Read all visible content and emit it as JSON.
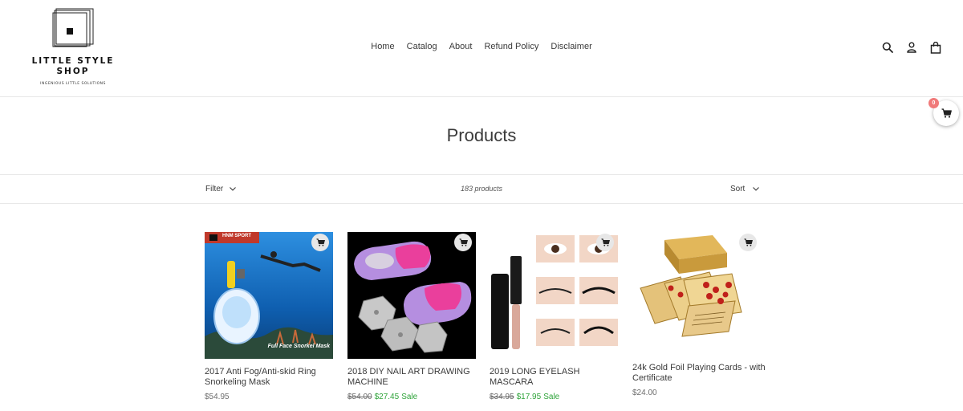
{
  "brand": {
    "name_line1": "LITTLE STYLE",
    "name_line2": "SHOP",
    "tagline": "INGENIOUS LITTLE SOLUTIONS"
  },
  "nav": [
    "Home",
    "Catalog",
    "About",
    "Refund Policy",
    "Disclaimer"
  ],
  "header_icons": [
    "search-icon",
    "account-icon",
    "bag-icon"
  ],
  "floating_cart": {
    "count": "0",
    "icon": "cart-icon"
  },
  "page_title": "Products",
  "filter_bar": {
    "filter_label": "Filter",
    "count_label": "183 products",
    "sort_label": "Sort"
  },
  "products": [
    {
      "title": "2017 Anti Fog/Anti-skid Ring Snorkeling Mask",
      "price": "$54.95",
      "image_caption": "Full Face Snorkel Mask",
      "image_logo": "HNM SPORT"
    },
    {
      "title": "2018 DIY NAIL ART DRAWING MACHINE",
      "compare_price": "$54.00",
      "sale_price": "$27.45",
      "sale_label": "Sale"
    },
    {
      "title": "2019 LONG EYELASH MASCARA",
      "compare_price": "$34.95",
      "sale_price": "$17.95",
      "sale_label": "Sale"
    },
    {
      "title": "24k Gold Foil Playing Cards - with Certificate",
      "price": "$24.00"
    }
  ],
  "colors": {
    "sale": "#2fa43a",
    "badge": "#f07a7a",
    "text": "#3a3a3a"
  }
}
